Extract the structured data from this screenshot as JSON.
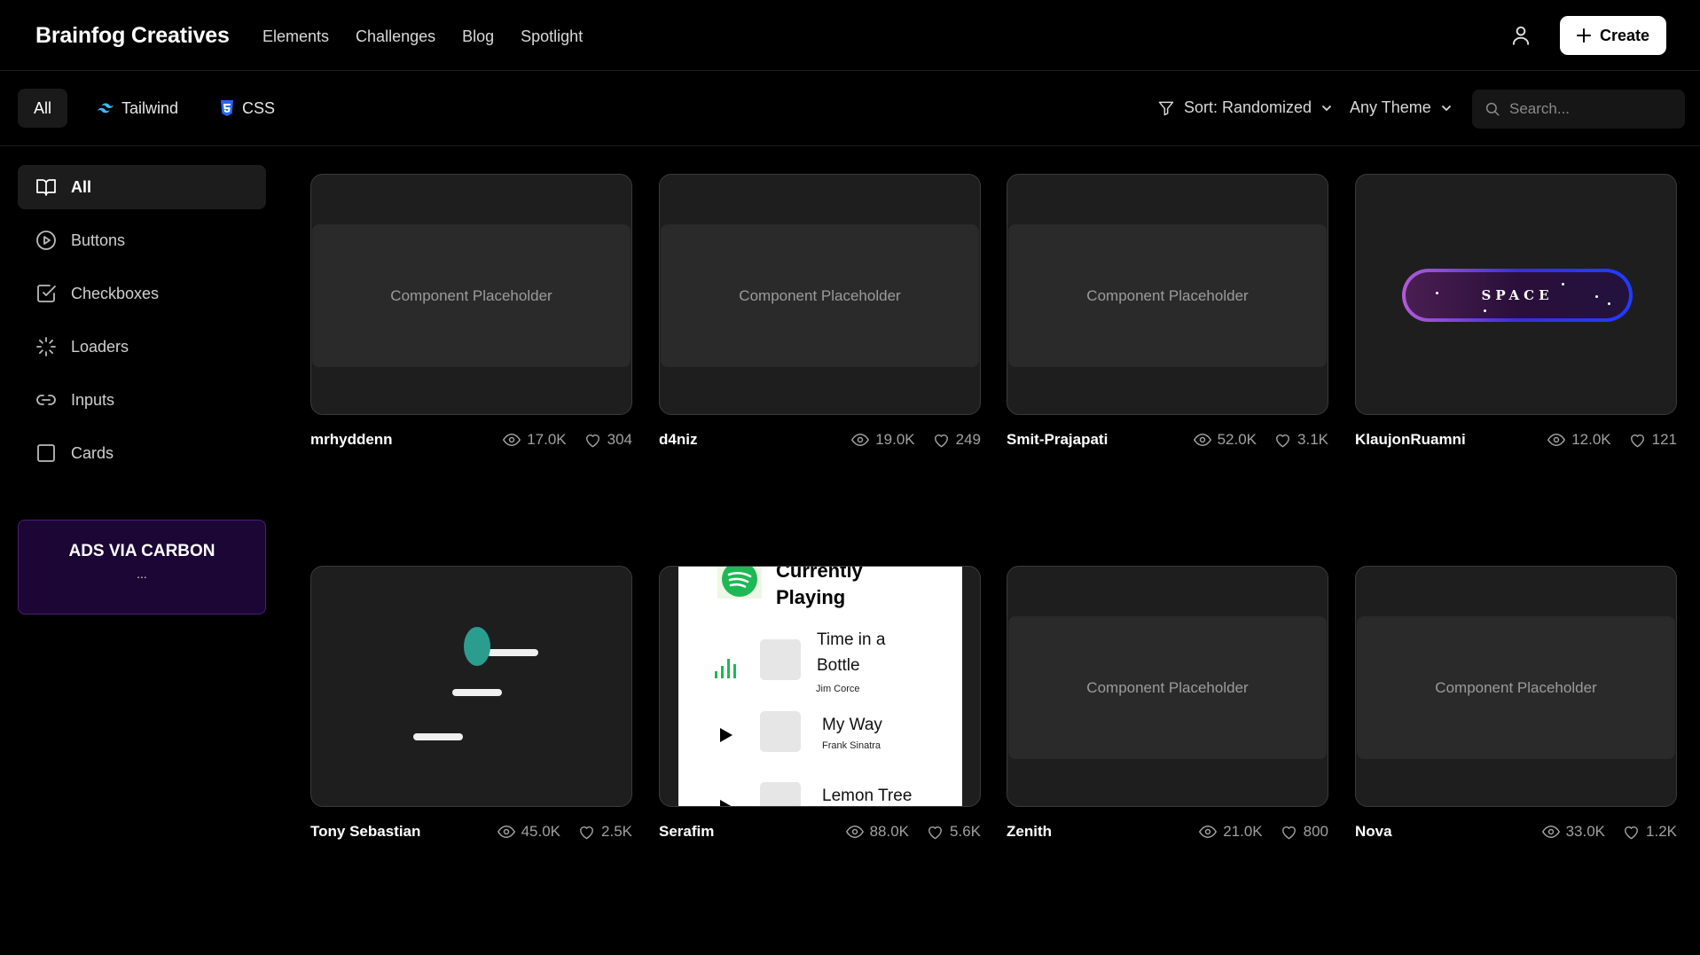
{
  "brand": "Brainfog Creatives",
  "nav": [
    "Elements",
    "Challenges",
    "Blog",
    "Spotlight"
  ],
  "create_label": "Create",
  "filter_tabs": [
    "All",
    "Tailwind",
    "CSS"
  ],
  "sort_label": "Sort: Randomized",
  "theme_label": "Any Theme",
  "search_placeholder": "Search...",
  "sidebar": [
    "All",
    "Buttons",
    "Checkboxes",
    "Loaders",
    "Inputs",
    "Cards"
  ],
  "ad": {
    "title": "ADS VIA CARBON",
    "dots": "..."
  },
  "placeholder_text": "Component Placeholder",
  "cards": [
    {
      "author": "mrhyddenn",
      "views": "17.0K",
      "likes": "304"
    },
    {
      "author": "d4niz",
      "views": "19.0K",
      "likes": "249"
    },
    {
      "author": "Smit-Prajapati",
      "views": "52.0K",
      "likes": "3.1K"
    },
    {
      "author": "KlaujonRuamni",
      "views": "12.0K",
      "likes": "121"
    },
    {
      "author": "Tony Sebastian",
      "views": "45.0K",
      "likes": "2.5K"
    },
    {
      "author": "Serafim",
      "views": "88.0K",
      "likes": "5.6K"
    },
    {
      "author": "Zenith",
      "views": "21.0K",
      "likes": "800"
    },
    {
      "author": "Nova",
      "views": "33.0K",
      "likes": "1.2K"
    }
  ],
  "space_label": "SPACE",
  "spotify": {
    "title_line1": "Currently",
    "title_line2": "Playing",
    "tracks": [
      {
        "name_line1": "Time in a",
        "name_line2": "Bottle",
        "artist": "Jim Corce"
      },
      {
        "name_line1": "My Way",
        "artist": "Frank Sinatra"
      },
      {
        "name_line1": "Lemon Tree"
      }
    ]
  }
}
